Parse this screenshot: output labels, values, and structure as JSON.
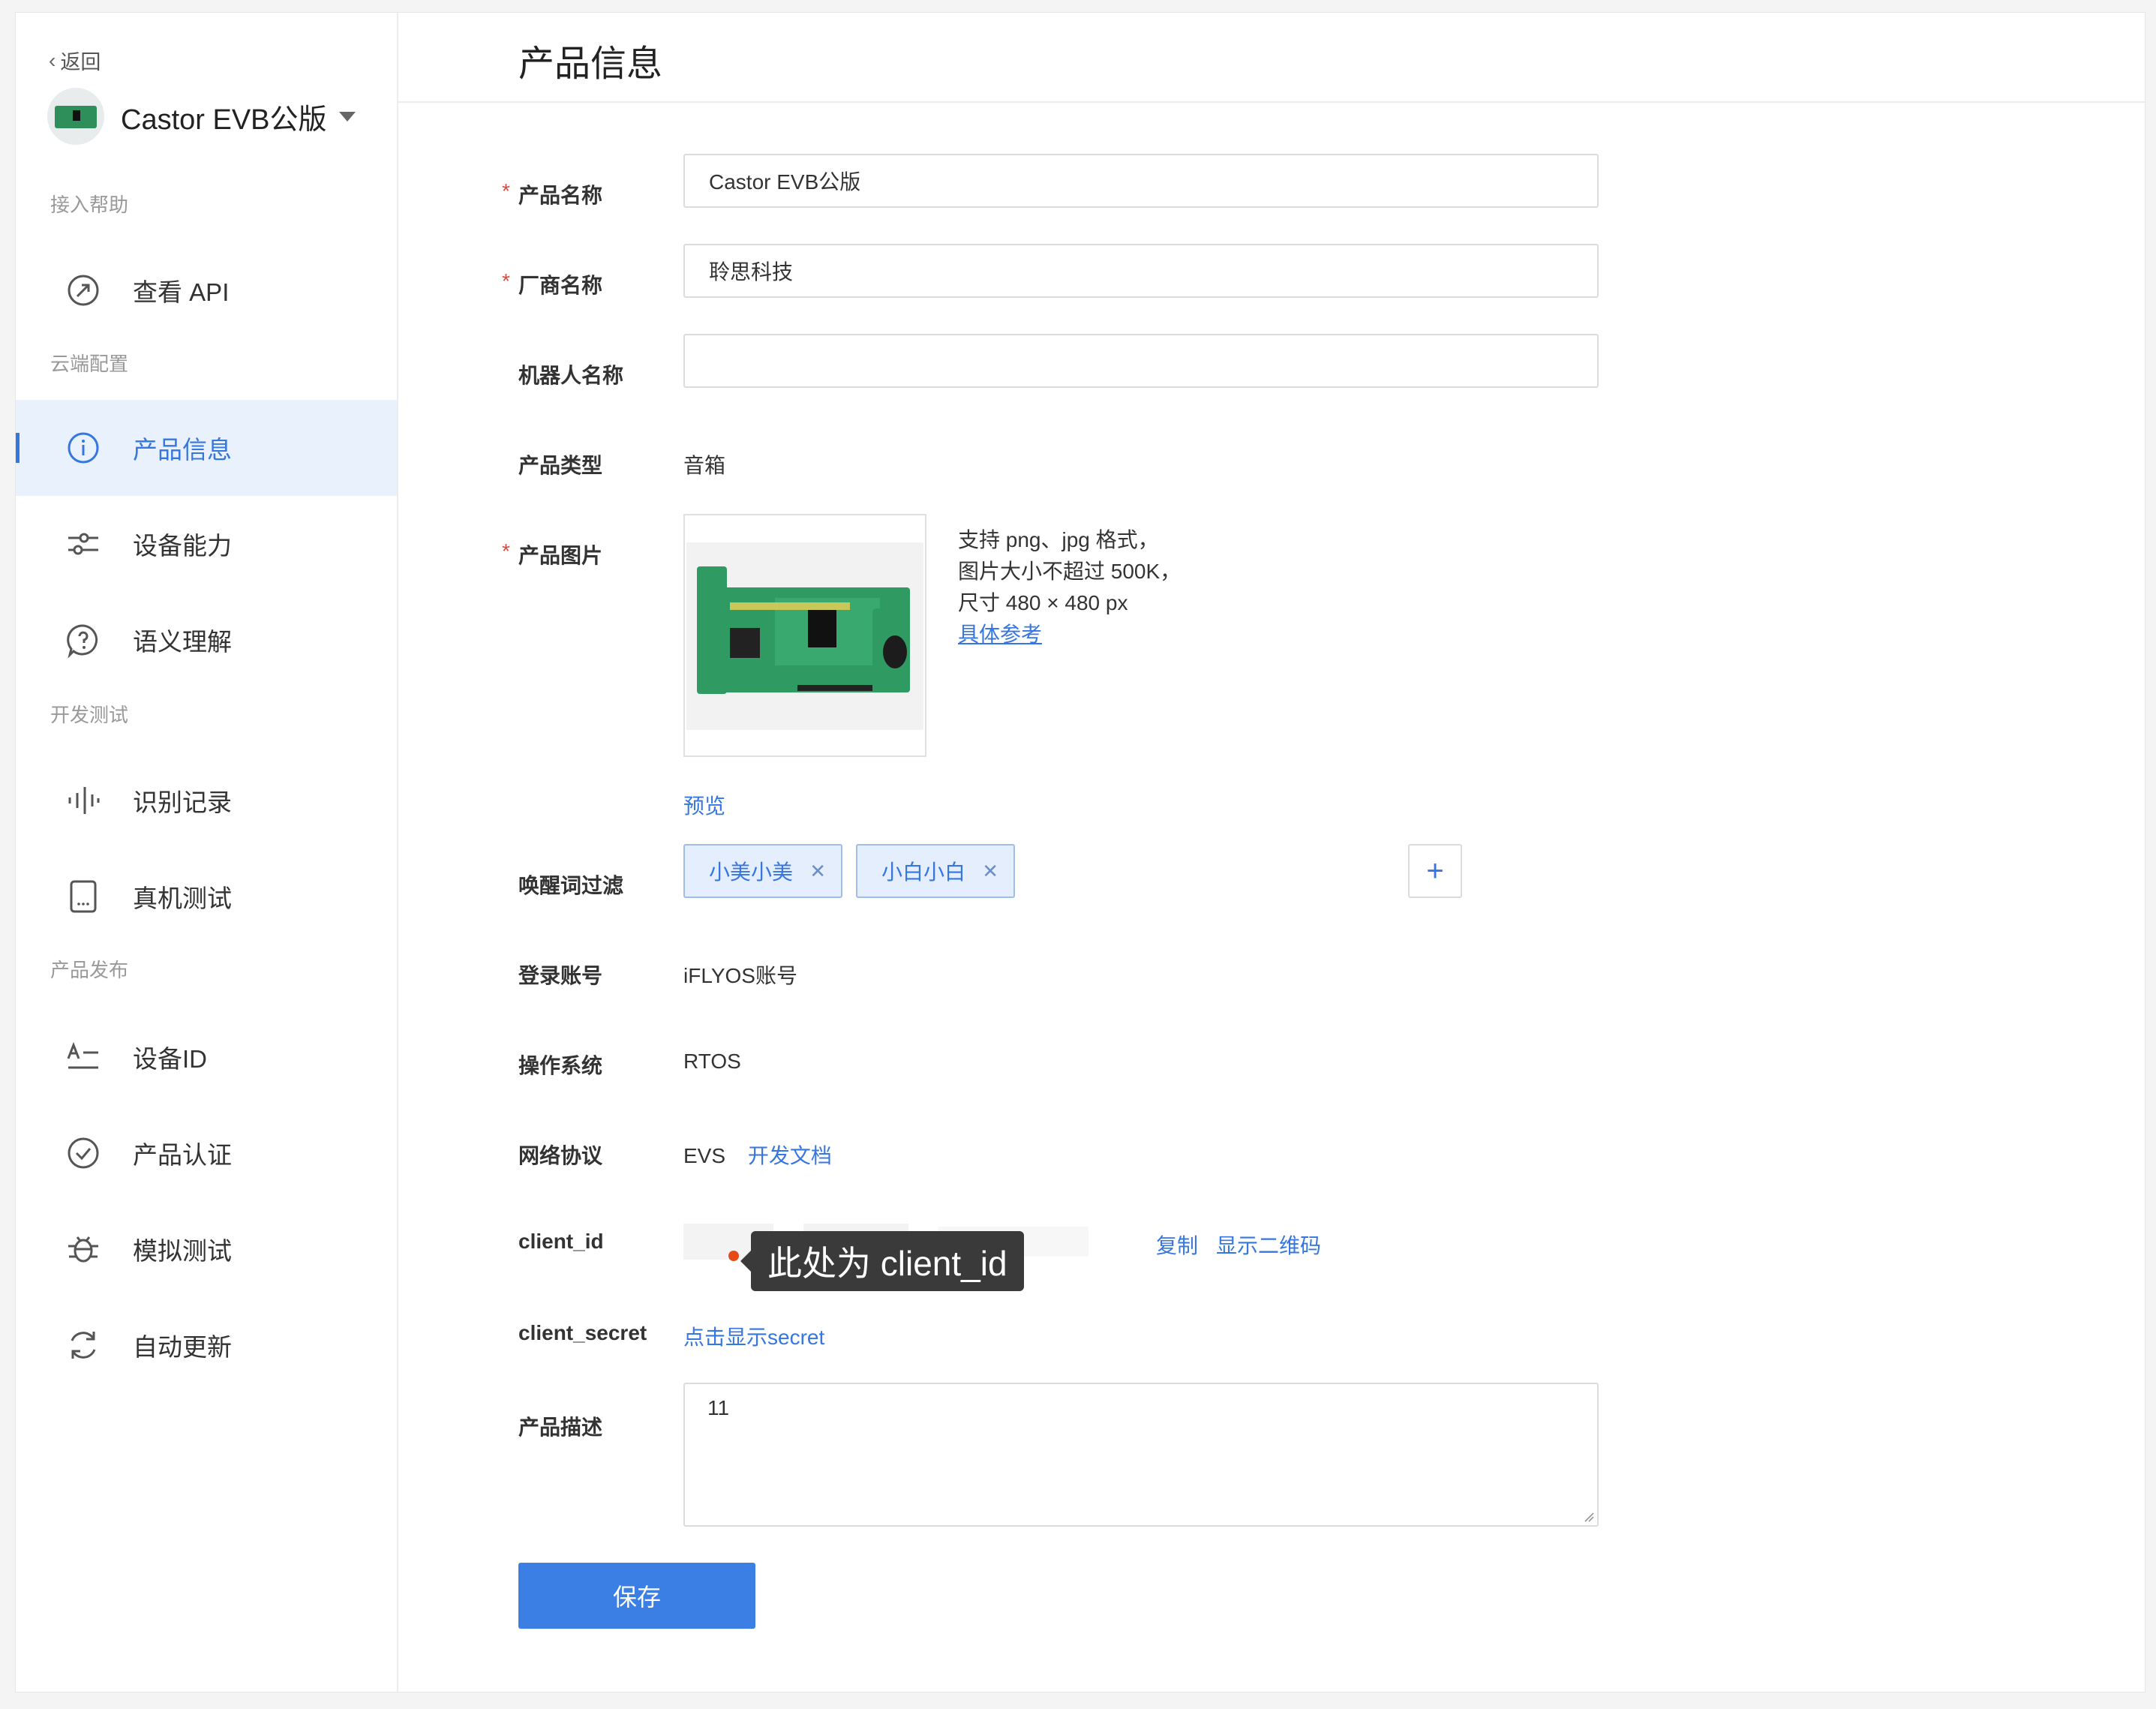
{
  "sidebar": {
    "back_label": "返回",
    "product_name": "Castor EVB公版",
    "sections": {
      "help": "接入帮助",
      "cloud": "云端配置",
      "dev": "开发测试",
      "publish": "产品发布"
    },
    "items": [
      {
        "label": "查看 API",
        "icon": "api-compass-icon"
      },
      {
        "label": "产品信息",
        "icon": "info-icon",
        "active": true
      },
      {
        "label": "设备能力",
        "icon": "sliders-icon"
      },
      {
        "label": "语义理解",
        "icon": "question-bubble-icon"
      },
      {
        "label": "识别记录",
        "icon": "waveform-icon"
      },
      {
        "label": "真机测试",
        "icon": "device-icon"
      },
      {
        "label": "设备ID",
        "icon": "text-id-icon"
      },
      {
        "label": "产品认证",
        "icon": "check-circle-icon"
      },
      {
        "label": "模拟测试",
        "icon": "bug-icon"
      },
      {
        "label": "自动更新",
        "icon": "refresh-icon"
      }
    ]
  },
  "page": {
    "title": "产品信息"
  },
  "form": {
    "product_name": {
      "label": "产品名称",
      "value": "Castor EVB公版",
      "required": true
    },
    "vendor_name": {
      "label": "厂商名称",
      "value": "聆思科技",
      "required": true
    },
    "robot_name": {
      "label": "机器人名称",
      "value": ""
    },
    "product_type": {
      "label": "产品类型",
      "value": "音箱"
    },
    "product_image": {
      "label": "产品图片",
      "required": true,
      "hint_lines": [
        "支持 png、jpg 格式，",
        "图片大小不超过 500K，",
        "尺寸 480 × 480 px"
      ],
      "reference_link": "具体参考",
      "preview_link": "预览"
    },
    "wake_filter": {
      "label": "唤醒词过滤",
      "tags": [
        "小美小美",
        "小白小白"
      ],
      "add": "+"
    },
    "login_account": {
      "label": "登录账号",
      "value": "iFLYOS账号"
    },
    "os": {
      "label": "操作系统",
      "value": "RTOS"
    },
    "network": {
      "label": "网络协议",
      "value": "EVS",
      "doc_link": "开发文档"
    },
    "client_id": {
      "label": "client_id",
      "copy": "复制",
      "qr": "显示二维码",
      "tooltip": "此处为 client_id"
    },
    "client_secret": {
      "label": "client_secret",
      "reveal": "点击显示secret"
    },
    "description": {
      "label": "产品描述",
      "value": "11"
    },
    "save": "保存"
  },
  "colors": {
    "accent": "#3576e0",
    "required": "#e5463a",
    "tooltip_bg": "#3a3a3a"
  }
}
